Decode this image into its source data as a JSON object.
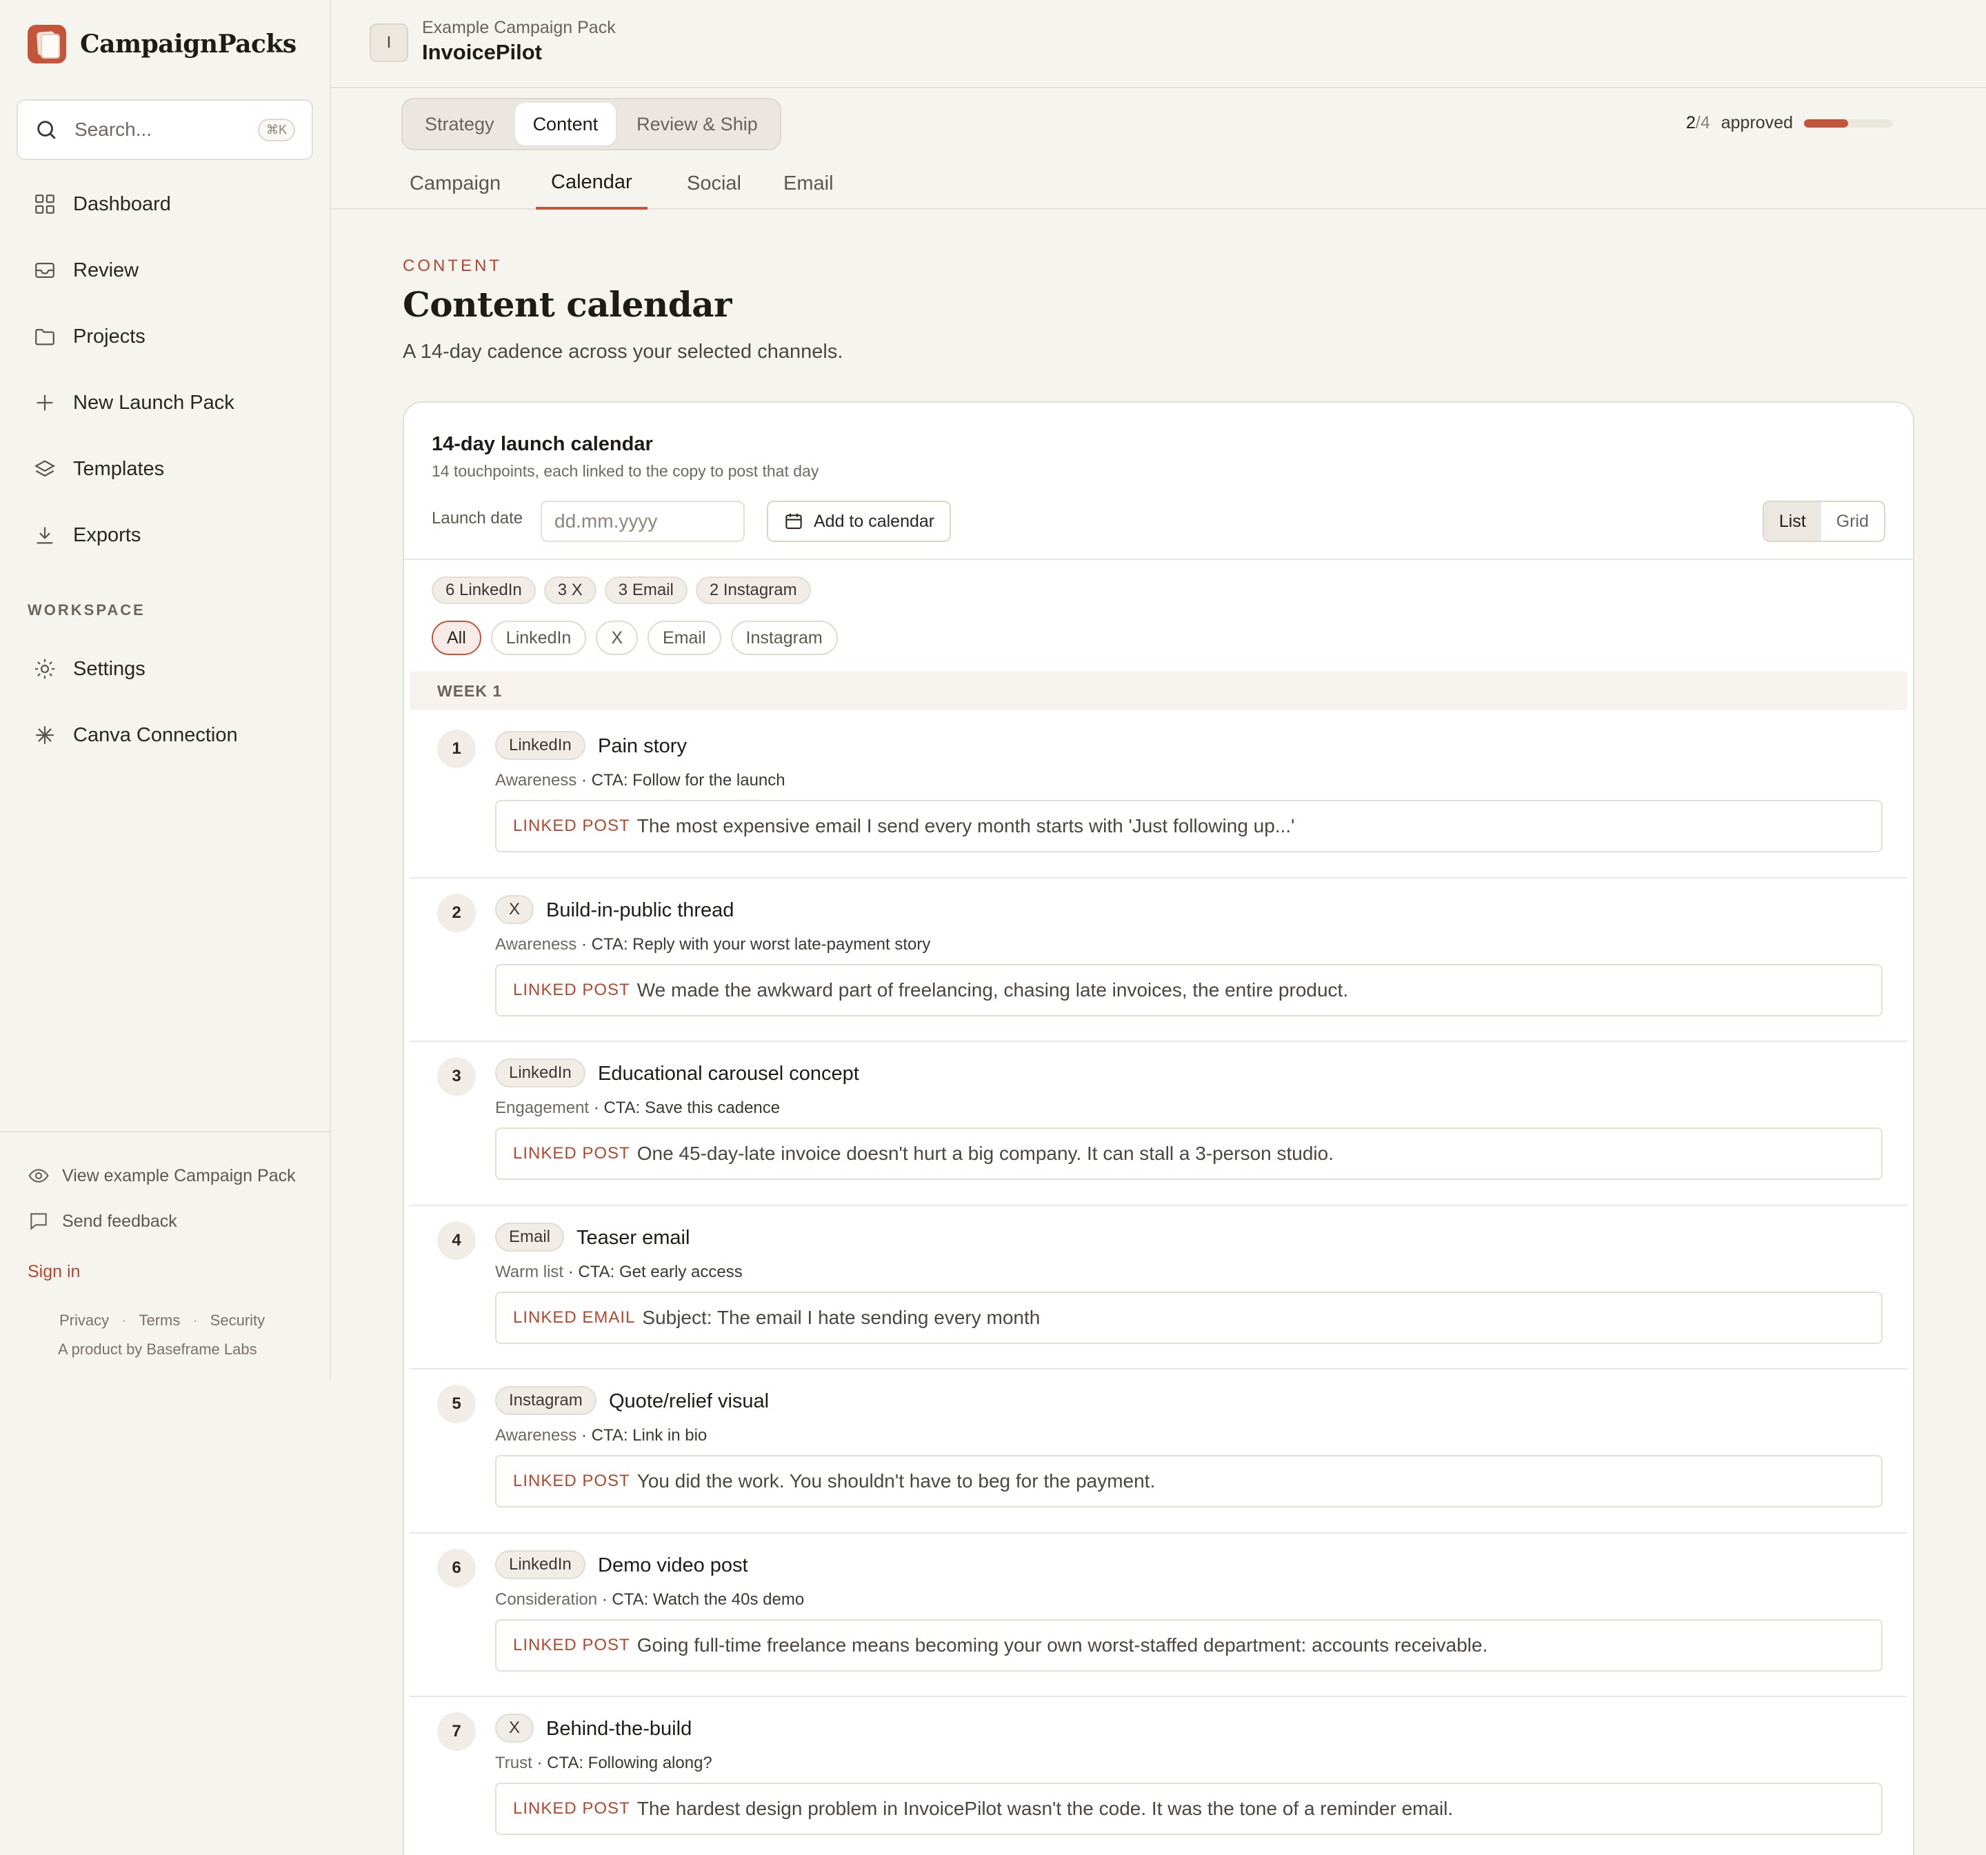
{
  "brand": {
    "name": "CampaignPacks"
  },
  "search": {
    "placeholder": "Search...",
    "shortcut": "⌘K"
  },
  "nav": {
    "items": [
      {
        "label": "Dashboard",
        "icon": "grid-icon"
      },
      {
        "label": "Review",
        "icon": "inbox-icon"
      },
      {
        "label": "Projects",
        "icon": "folder-icon"
      },
      {
        "label": "New Launch Pack",
        "icon": "plus-icon"
      },
      {
        "label": "Templates",
        "icon": "layers-icon"
      },
      {
        "label": "Exports",
        "icon": "download-icon"
      }
    ],
    "workspace_label": "WORKSPACE",
    "workspace_items": [
      {
        "label": "Settings",
        "icon": "gear-icon"
      },
      {
        "label": "Canva Connection",
        "icon": "sparkle-icon"
      }
    ]
  },
  "sidebar_footer": {
    "view_example": "View example Campaign Pack",
    "feedback": "Send feedback",
    "sign_in": "Sign in",
    "privacy": "Privacy",
    "terms": "Terms",
    "security": "Security",
    "byline": "A product by Baseframe Labs"
  },
  "header": {
    "avatar_initial": "I",
    "kicker": "Example Campaign Pack",
    "project": "InvoicePilot",
    "segments": [
      "Strategy",
      "Content",
      "Review & Ship"
    ],
    "active_segment": "Content",
    "approved_count": "2",
    "approved_total": "/4",
    "approved_label": "approved",
    "approved_fraction": 0.5,
    "subtabs": [
      "Campaign",
      "Calendar",
      "Social",
      "Email"
    ],
    "active_subtab": "Calendar"
  },
  "page": {
    "eyebrow": "CONTENT",
    "title": "Content calendar",
    "subtitle": "A 14-day cadence across your selected channels."
  },
  "calendar": {
    "title": "14-day launch calendar",
    "subtitle": "14 touchpoints, each linked to the copy to post that day",
    "launch_label": "Launch date",
    "launch_placeholder": "dd.mm.yyyy",
    "add_button": "Add to calendar",
    "view_list": "List",
    "view_grid": "Grid",
    "counts": [
      "6 LinkedIn",
      "3 X",
      "3 Email",
      "2 Instagram"
    ],
    "filters": [
      "All",
      "LinkedIn",
      "X",
      "Email",
      "Instagram"
    ],
    "week_label": "WEEK 1",
    "entries": [
      {
        "num": "1",
        "channel": "LinkedIn",
        "title": "Pain story",
        "stage": "Awareness",
        "cta": " · CTA: Follow for the launch",
        "link_label": "LINKED POST",
        "link_text": "The most expensive email I send every month starts with 'Just following up...'"
      },
      {
        "num": "2",
        "channel": "X",
        "title": "Build-in-public thread",
        "stage": "Awareness",
        "cta": " · CTA: Reply with your worst late-payment story",
        "link_label": "LINKED POST",
        "link_text": "We made the awkward part of freelancing, chasing late invoices, the entire product."
      },
      {
        "num": "3",
        "channel": "LinkedIn",
        "title": "Educational carousel concept",
        "stage": "Engagement",
        "cta": " · CTA: Save this cadence",
        "link_label": "LINKED POST",
        "link_text": "One 45-day-late invoice doesn't hurt a big company. It can stall a 3-person studio."
      },
      {
        "num": "4",
        "channel": "Email",
        "title": "Teaser email",
        "stage": "Warm list",
        "cta": " · CTA: Get early access",
        "link_label": "LINKED EMAIL",
        "link_text": "Subject: The email I hate sending every month"
      },
      {
        "num": "5",
        "channel": "Instagram",
        "title": "Quote/relief visual",
        "stage": "Awareness",
        "cta": " · CTA: Link in bio",
        "link_label": "LINKED POST",
        "link_text": "You did the work. You shouldn't have to beg for the payment."
      },
      {
        "num": "6",
        "channel": "LinkedIn",
        "title": "Demo video post",
        "stage": "Consideration",
        "cta": " · CTA: Watch the 40s demo",
        "link_label": "LINKED POST",
        "link_text": "Going full-time freelance means becoming your own worst-staffed department: accounts receivable."
      },
      {
        "num": "7",
        "channel": "X",
        "title": "Behind-the-build",
        "stage": "Trust",
        "cta": " · CTA: Following along?",
        "link_label": "LINKED POST",
        "link_text": "The hardest design problem in InvoicePilot wasn't the code. It was the tone of a reminder email."
      }
    ]
  },
  "colors": {
    "accent": "#c2553a",
    "background": "#f6f4ef",
    "card": "#ffffff"
  }
}
